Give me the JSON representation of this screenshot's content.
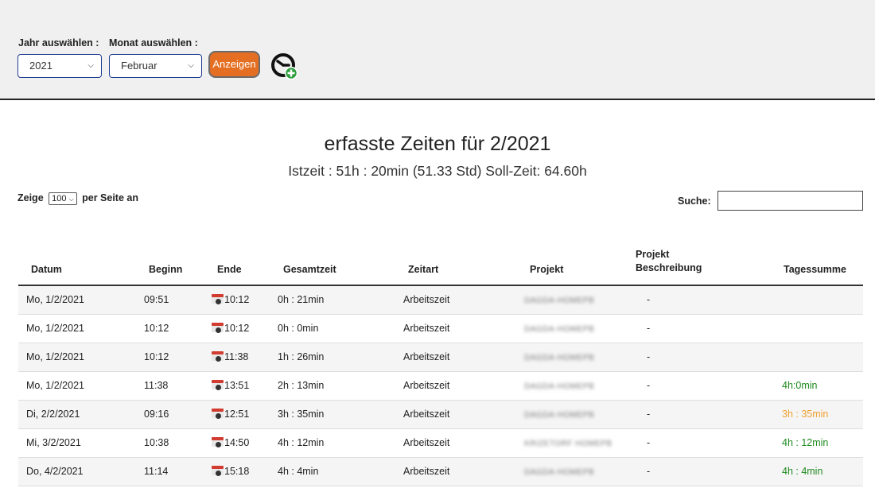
{
  "filters": {
    "year_label": "Jahr auswählen :",
    "month_label": "Monat auswählen :",
    "year_value": "2021",
    "month_value": "Februar",
    "show_button": "Anzeigen"
  },
  "title": "erfasste Zeiten für 2/2021",
  "summary": "Istzeit : 51h : 20min (51.33 Std) Soll-Zeit: 64.60h",
  "table_controls": {
    "show_prefix": "Zeige",
    "page_size": "100",
    "show_suffix": "per Seite an",
    "search_label": "Suche:"
  },
  "columns": {
    "date": "Datum",
    "start": "Beginn",
    "end": "Ende",
    "total": "Gesamtzeit",
    "type": "Zeitart",
    "project": "Projekt",
    "desc_line1": "Projekt",
    "desc_line2": "Beschreibung",
    "daysum": "Tagessumme"
  },
  "rows": [
    {
      "date": "Mo, 1/2/2021",
      "start": "09:51",
      "end": "10:12",
      "total": "0h : 21min",
      "type": "Arbeitszeit",
      "project": "DAGDA-HOMEPB",
      "desc": "-",
      "daysum": "",
      "daysum_color": ""
    },
    {
      "date": "Mo, 1/2/2021",
      "start": "10:12",
      "end": "10:12",
      "total": "0h : 0min",
      "type": "Arbeitszeit",
      "project": "DAGDA-HOMEPB",
      "desc": "-",
      "daysum": "",
      "daysum_color": ""
    },
    {
      "date": "Mo, 1/2/2021",
      "start": "10:12",
      "end": "11:38",
      "total": "1h : 26min",
      "type": "Arbeitszeit",
      "project": "DAGDA-HOMEPB",
      "desc": "-",
      "daysum": "",
      "daysum_color": ""
    },
    {
      "date": "Mo, 1/2/2021",
      "start": "11:38",
      "end": "13:51",
      "total": "2h : 13min",
      "type": "Arbeitszeit",
      "project": "DAGDA-HOMEPB",
      "desc": "-",
      "daysum": "4h:0min",
      "daysum_color": "green"
    },
    {
      "date": "Di, 2/2/2021",
      "start": "09:16",
      "end": "12:51",
      "total": "3h : 35min",
      "type": "Arbeitszeit",
      "project": "DAGDA-HOMEPB",
      "desc": "-",
      "daysum": "3h : 35min",
      "daysum_color": "orange"
    },
    {
      "date": "Mi, 3/2/2021",
      "start": "10:38",
      "end": "14:50",
      "total": "4h : 12min",
      "type": "Arbeitszeit",
      "project": "KRIZETORF HOMEPB",
      "desc": "-",
      "daysum": "4h : 12min",
      "daysum_color": "green"
    },
    {
      "date": "Do, 4/2/2021",
      "start": "11:14",
      "end": "15:18",
      "total": "4h : 4min",
      "type": "Arbeitszeit",
      "project": "DAGDA-HOMEPB",
      "desc": "-",
      "daysum": "4h : 4min",
      "daysum_color": "green"
    }
  ],
  "colors": {
    "accent": "#e46f22",
    "select_border": "#1f3b8f",
    "sum_ok": "#1e8a1e",
    "sum_low": "#f0a030"
  }
}
